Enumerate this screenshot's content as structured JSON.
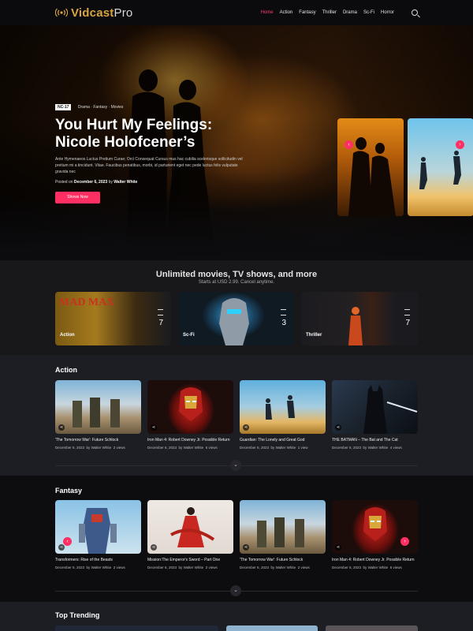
{
  "header": {
    "logo_a": "Vidcast",
    "logo_b": "Pro",
    "nav": [
      "Home",
      "Action",
      "Fantasy",
      "Thriller",
      "Drama",
      "Sc-Fi",
      "Horror"
    ],
    "active_index": 0
  },
  "hero": {
    "rating": "NC-17",
    "genres": "Drama · Fantasy · Movies",
    "title_line1": "You Hurt My Feelings:",
    "title_line2": "Nicole Holofcener’s",
    "description": "Ante Hymenaeos Luctus Pretium Curae; Orci Consequat Cursus mus hac cubilia scelerisque sollicitudin vel pretium mi a tincidunt. Vitae. Faucibus penatibus, morbi, id parturient eget nec pede luctus felis vulputate gravida nec",
    "posted_prefix": "Posted on",
    "posted_date": "December 6, 2023",
    "posted_by": "by",
    "author": "Walter White",
    "button": "Shows Now"
  },
  "subscription": {
    "title": "Unlimited movies, TV shows, and more",
    "subtitle": "Starts at USD 2.99. Cancel anytime.",
    "genres": [
      {
        "label": "Action",
        "count": "7"
      },
      {
        "label": "Sc-Fi",
        "count": "3"
      },
      {
        "label": "Thriller",
        "count": "7"
      }
    ]
  },
  "action": {
    "title": "Action",
    "cards": [
      {
        "title": "'The Tomorrow War': Future Schlock",
        "date": "December 6, 2023",
        "by": "by",
        "author": "Walter White",
        "views": "2 views"
      },
      {
        "title": "Iron Man 4: Robert Downey Jr. Possible Return",
        "date": "December 6, 2023",
        "by": "by",
        "author": "Walter White",
        "views": "6 views"
      },
      {
        "title": "Guardian: The Lonely and Great God",
        "date": "December 6, 2023",
        "by": "by",
        "author": "Walter White",
        "views": "1 view"
      },
      {
        "title": "THE BATMAN – The Bat and The Cat",
        "date": "December 6, 2023",
        "by": "by",
        "author": "Walter White",
        "views": "4 views"
      }
    ]
  },
  "fantasy": {
    "title": "Fantasy",
    "cards": [
      {
        "title": "Transformers: Rise of the Beasts",
        "date": "December 6, 2023",
        "by": "by",
        "author": "Walter White",
        "views": "2 views"
      },
      {
        "title": "Mission:The Emperor's Sword – Part One",
        "date": "December 6, 2023",
        "by": "by",
        "author": "Walter White",
        "views": "2 views"
      },
      {
        "title": "'The Tomorrow War': Future Schlock",
        "date": "December 6, 2023",
        "by": "by",
        "author": "Walter White",
        "views": "2 views"
      },
      {
        "title": "Iron Man 4: Robert Downey Jr. Possible Return",
        "date": "December 6, 2023",
        "by": "by",
        "author": "Walter White",
        "views": "6 views"
      }
    ]
  },
  "trending": {
    "title": "Top Trending"
  },
  "icons": {
    "prev": "‹",
    "next": "›",
    "more": "⌄",
    "share": "⋖"
  },
  "colors": {
    "accent": "#ff2e63",
    "brand_gold": "#d9a441"
  }
}
